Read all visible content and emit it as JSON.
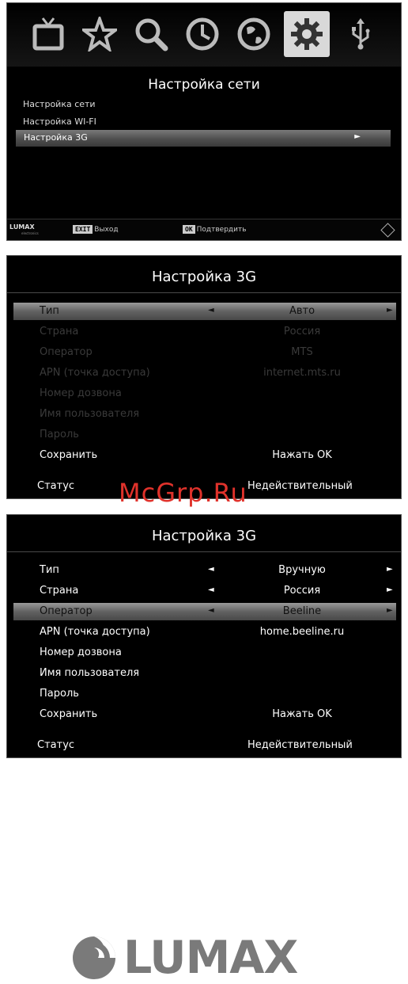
{
  "network_menu": {
    "title": "Настройка сети",
    "items": [
      {
        "label": "Настройка сети"
      },
      {
        "label": "Настройка WI-FI"
      },
      {
        "label": "Настройка 3G",
        "arrow": "►"
      }
    ],
    "footer": {
      "brand": "LUMAX",
      "brand_sub": "electronics",
      "exit_key": "EXIT",
      "exit_label": "Выход",
      "ok_key": "OK",
      "ok_label": "Подтвердить"
    },
    "icons": [
      "tv-icon",
      "star-icon",
      "search-icon",
      "clock-icon",
      "globe-icon",
      "gear-icon",
      "usb-icon"
    ],
    "selected_icon": "gear-icon"
  },
  "auto_3g": {
    "title": "Настройка 3G",
    "rows": [
      {
        "label": "Тип",
        "value": "Авто",
        "left_arrow": "◄",
        "right_arrow": "►"
      },
      {
        "label": "Страна",
        "value": "Россия"
      },
      {
        "label": "Оператор",
        "value": "MTS"
      },
      {
        "label": "APN (точка доступа)",
        "value": "internet.mts.ru"
      },
      {
        "label": "Номер дозвона",
        "value": ""
      },
      {
        "label": "Имя пользователя",
        "value": ""
      },
      {
        "label": "Пароль",
        "value": ""
      },
      {
        "label": "Сохранить",
        "value": "Нажать OK"
      }
    ],
    "status": {
      "label": "Статус",
      "value": "Недействительный"
    }
  },
  "manual_3g": {
    "title": "Настройка 3G",
    "rows": [
      {
        "label": "Тип",
        "value": "Вручную",
        "left_arrow": "◄",
        "right_arrow": "►"
      },
      {
        "label": "Страна",
        "value": "Россия",
        "left_arrow": "◄",
        "right_arrow": "►"
      },
      {
        "label": "Оператор",
        "value": "Beeline",
        "left_arrow": "◄",
        "right_arrow": "►"
      },
      {
        "label": "APN (точка доступа)",
        "value": "home.beeline.ru"
      },
      {
        "label": "Номер дозвона",
        "value": ""
      },
      {
        "label": "Имя пользователя",
        "value": ""
      },
      {
        "label": "Пароль",
        "value": ""
      },
      {
        "label": "Сохранить",
        "value": "Нажать OK"
      }
    ],
    "status": {
      "label": "Статус",
      "value": "Недействительный"
    }
  },
  "watermark": "McGrp.Ru",
  "brand_logo": "LUMAX",
  "colors": {
    "highlight": "#6b6b6b",
    "background": "#000000",
    "watermark": "#e0322b",
    "brand": "#7a7a7a"
  }
}
